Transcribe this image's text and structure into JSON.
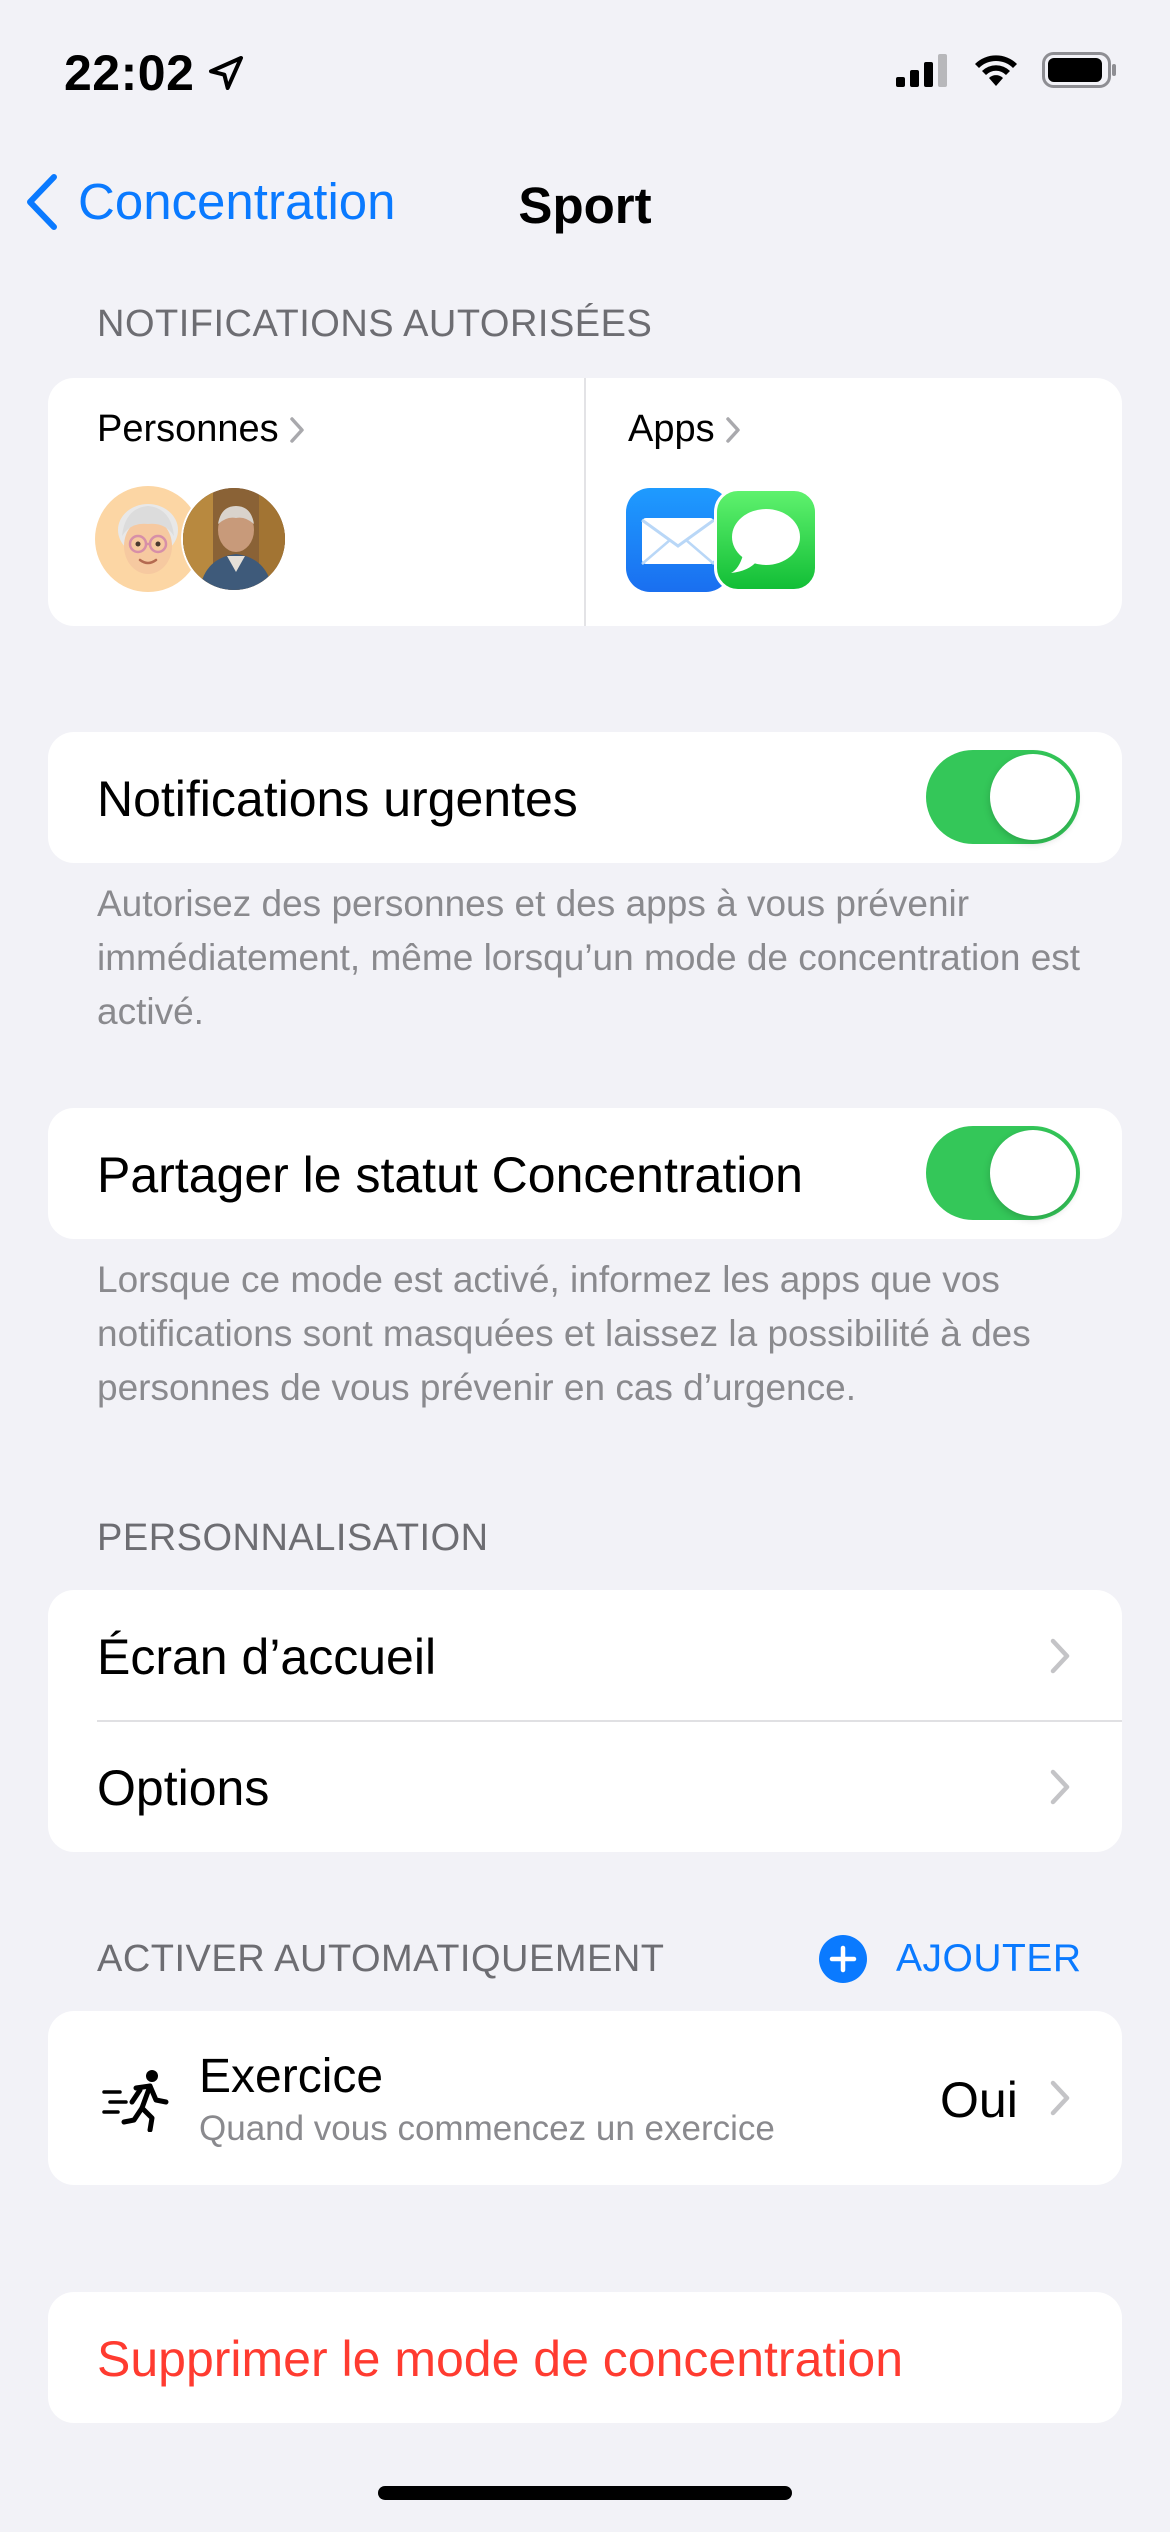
{
  "status": {
    "time": "22:02"
  },
  "nav": {
    "back_label": "Concentration",
    "title": "Sport"
  },
  "allowed": {
    "header": "NOTIFICATIONS AUTORISÉES",
    "people_label": "Personnes",
    "apps_label": "Apps",
    "apps": [
      "mail-icon",
      "messages-icon"
    ]
  },
  "urgent": {
    "label": "Notifications urgentes",
    "on": true,
    "footer": "Autorisez des personnes et des apps à vous prévenir immédiatement, même lorsqu’un mode de concentration est activé."
  },
  "share": {
    "label": "Partager le statut Concentration",
    "on": true,
    "footer": "Lorsque ce mode est activé, informez les apps que vos notifications sont masquées et laissez la possibilité à des personnes de vous prévenir en cas d’urgence."
  },
  "customization": {
    "header": "PERSONNALISATION",
    "home_screen": "Écran d’accueil",
    "options": "Options"
  },
  "auto": {
    "header": "ACTIVER AUTOMATIQUEMENT",
    "add_label": "AJOUTER",
    "exercise_title": "Exercice",
    "exercise_subtitle": "Quand vous commencez un exercice",
    "exercise_value": "Oui"
  },
  "delete_label": "Supprimer le mode de concentration",
  "colors": {
    "accent": "#0a7aff",
    "toggle_on": "#34c759",
    "destructive": "#ff3b30",
    "background": "#f2f2f7"
  }
}
